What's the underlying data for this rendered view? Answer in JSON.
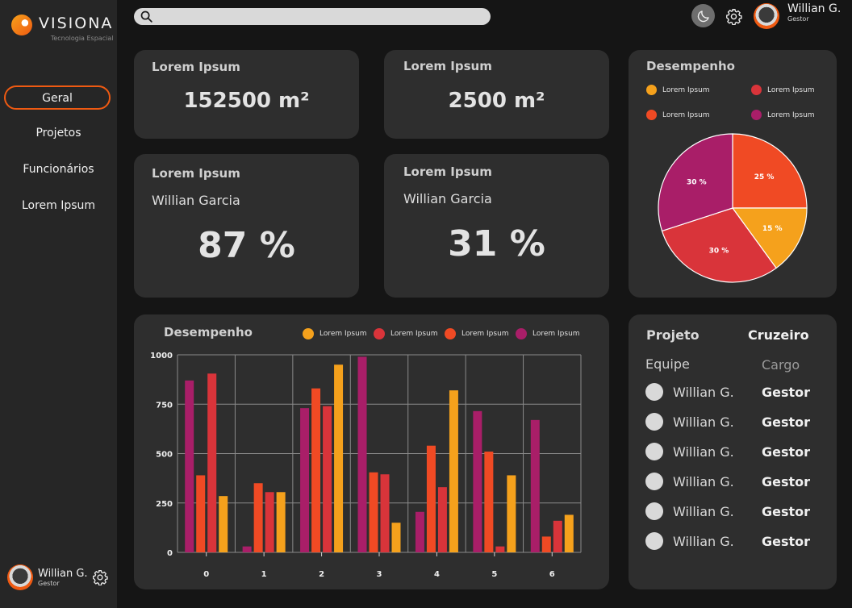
{
  "brand": {
    "name": "VISIONA",
    "tagline": "Tecnologia Espacial"
  },
  "nav": {
    "items": [
      {
        "label": "Geral",
        "active": true
      },
      {
        "label": "Projetos",
        "active": false
      },
      {
        "label": "Funcionários",
        "active": false
      },
      {
        "label": "Lorem Ipsum",
        "active": false
      }
    ]
  },
  "user": {
    "name": "Willian G.",
    "role": "Gestor"
  },
  "header": {
    "search_placeholder": ""
  },
  "cards": {
    "area1": {
      "title": "Lorem Ipsum",
      "value": "152500 m²"
    },
    "area2": {
      "title": "Lorem Ipsum",
      "value": "2500 m²"
    },
    "perf1": {
      "title": "Lorem Ipsum",
      "name": "Willian Garcia",
      "value": "87 %"
    },
    "perf2": {
      "title": "Lorem Ipsum",
      "name": "Willian Garcia",
      "value": "31 %"
    }
  },
  "pie_card": {
    "title": "Desempenho",
    "legend": [
      {
        "label": "Lorem Ipsum",
        "color": "#f5a11c"
      },
      {
        "label": "Lorem Ipsum",
        "color": "#d9343a"
      },
      {
        "label": "Lorem Ipsum",
        "color": "#f04a24"
      },
      {
        "label": "Lorem Ipsum",
        "color": "#a91e68"
      }
    ]
  },
  "bar_card": {
    "title": "Desempenho",
    "legend": [
      {
        "label": "Lorem Ipsum",
        "color": "#f5a11c"
      },
      {
        "label": "Lorem Ipsum",
        "color": "#d9343a"
      },
      {
        "label": "Lorem Ipsum",
        "color": "#f04a24"
      },
      {
        "label": "Lorem Ipsum",
        "color": "#a91e68"
      }
    ]
  },
  "team": {
    "project_label": "Projeto",
    "project_name": "Cruzeiro",
    "col_team": "Equipe",
    "col_role": "Cargo",
    "members": [
      {
        "name": "Willian G.",
        "role": "Gestor"
      },
      {
        "name": "Willian G.",
        "role": "Gestor"
      },
      {
        "name": "Willian G.",
        "role": "Gestor"
      },
      {
        "name": "Willian G.",
        "role": "Gestor"
      },
      {
        "name": "Willian G.",
        "role": "Gestor"
      },
      {
        "name": "Willian G.",
        "role": "Gestor"
      }
    ]
  },
  "chart_data": [
    {
      "type": "pie",
      "title": "Desempenho",
      "slices": [
        {
          "label": "25 %",
          "value": 25,
          "color": "#f04a24"
        },
        {
          "label": "15 %",
          "value": 15,
          "color": "#f5a11c"
        },
        {
          "label": "30 %",
          "value": 30,
          "color": "#d9343a"
        },
        {
          "label": "30 %",
          "value": 30,
          "color": "#a91e68"
        }
      ]
    },
    {
      "type": "bar",
      "title": "Desempenho",
      "categories": [
        "0",
        "1",
        "2",
        "3",
        "4",
        "5",
        "6"
      ],
      "ylim": [
        0,
        1000
      ],
      "yticks": [
        0,
        250,
        500,
        750,
        1000
      ],
      "grid": true,
      "series": [
        {
          "color": "#a91e68",
          "values": [
            870,
            30,
            730,
            990,
            205,
            715,
            670
          ]
        },
        {
          "color": "#f04a24",
          "values": [
            390,
            350,
            830,
            405,
            540,
            510,
            80
          ]
        },
        {
          "color": "#d9343a",
          "values": [
            905,
            305,
            740,
            395,
            330,
            30,
            160
          ]
        },
        {
          "color": "#f5a11c",
          "values": [
            285,
            305,
            950,
            150,
            820,
            390,
            190
          ]
        }
      ]
    }
  ]
}
